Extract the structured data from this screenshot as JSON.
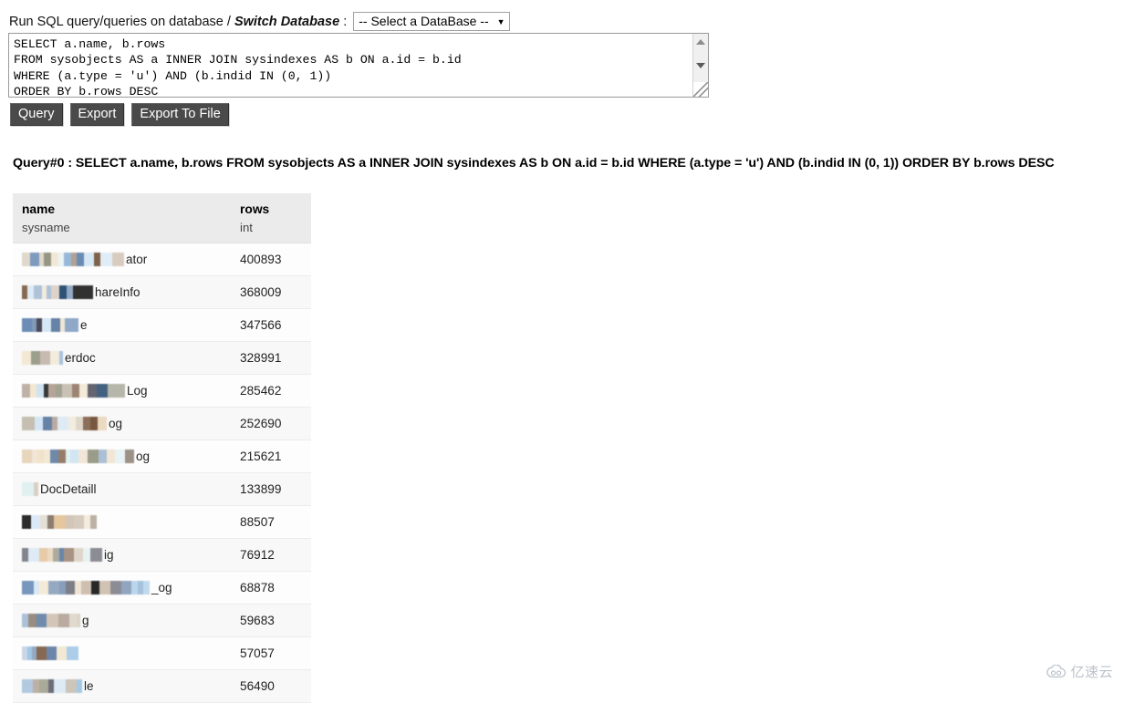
{
  "header": {
    "prefix": "Run SQL query/queries on database / ",
    "switch_database_label": "Switch Database",
    "colon": " :",
    "database_select": {
      "selected": "-- Select a DataBase --",
      "caret": "▼"
    }
  },
  "editor": {
    "sql": "SELECT a.name, b.rows\nFROM sysobjects AS a INNER JOIN sysindexes AS b ON a.id = b.id\nWHERE (a.type = 'u') AND (b.indid IN (0, 1))\nORDER BY b.rows DESC"
  },
  "toolbar": {
    "query_label": "Query",
    "export_label": "Export",
    "export_to_file_label": "Export To File"
  },
  "results": {
    "query_heading": "Query#0 : SELECT a.name, b.rows FROM sysobjects AS a INNER JOIN sysindexes AS b ON a.id = b.id WHERE (a.type = 'u') AND (b.indid IN (0, 1)) ORDER BY b.rows DESC",
    "columns": [
      {
        "name": "name",
        "type": "sysname"
      },
      {
        "name": "rows",
        "type": "int"
      }
    ],
    "rows": [
      {
        "name_visible": "ator",
        "name_redacted": true,
        "rows": "400893"
      },
      {
        "name_visible": "hareInfo",
        "name_redacted": true,
        "rows": "368009"
      },
      {
        "name_visible": "e",
        "name_redacted": true,
        "rows": "347566"
      },
      {
        "name_visible": "erdoc",
        "name_redacted": true,
        "rows": "328991"
      },
      {
        "name_visible": "Log",
        "name_redacted": true,
        "rows": "285462"
      },
      {
        "name_visible": "og",
        "name_redacted": true,
        "rows": "252690"
      },
      {
        "name_visible": "og",
        "name_redacted": true,
        "rows": "215621"
      },
      {
        "name_visible": "DocDetaill",
        "name_redacted": true,
        "rows": "133899"
      },
      {
        "name_visible": "",
        "name_redacted": true,
        "rows": "88507"
      },
      {
        "name_visible": "ig",
        "name_redacted": true,
        "rows": "76912"
      },
      {
        "name_visible": "_og",
        "name_redacted": true,
        "rows": "68878"
      },
      {
        "name_visible": "g",
        "name_redacted": true,
        "rows": "59683"
      },
      {
        "name_visible": "",
        "name_redacted": true,
        "rows": "57057"
      },
      {
        "name_visible": "le",
        "name_redacted": true,
        "rows": "56490"
      }
    ]
  },
  "watermark": {
    "text": "亿速云"
  },
  "colors": {
    "button_bg": "#4a4a4a",
    "table_header_bg": "#ebebeb",
    "page_bg": "#ffffff",
    "watermark": "#b9bfc9"
  }
}
